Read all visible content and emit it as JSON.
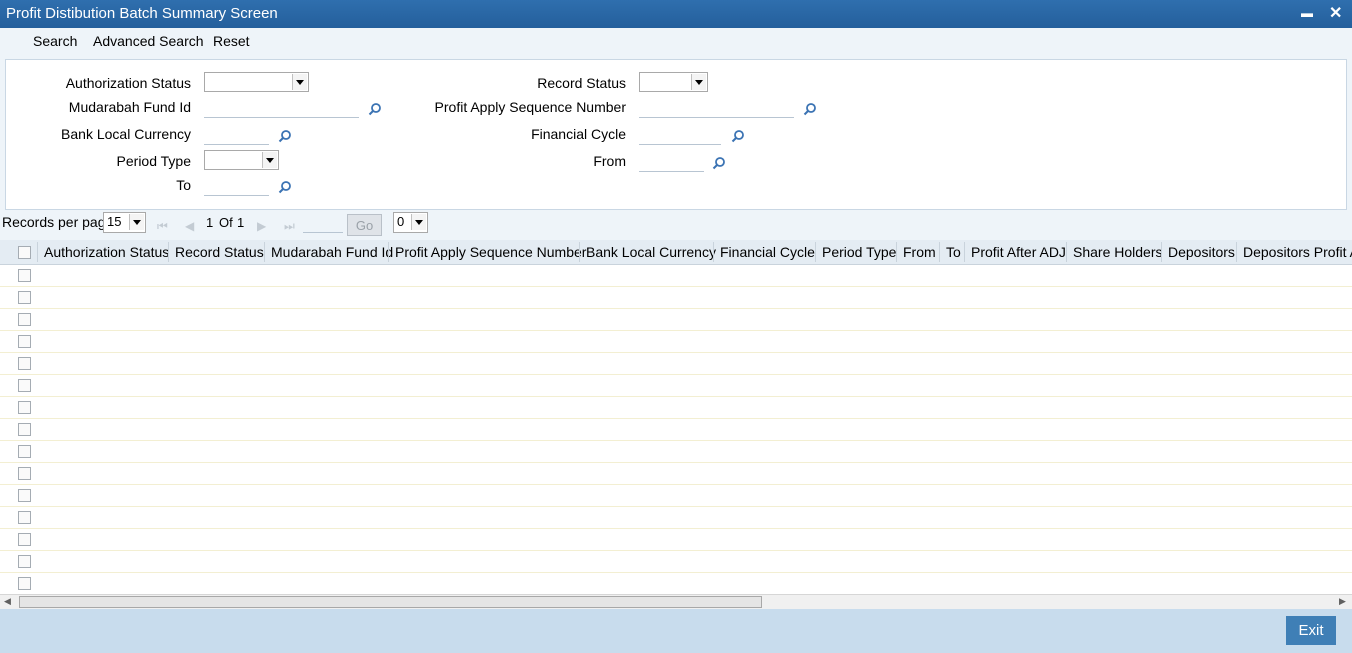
{
  "window": {
    "title": "Profit Distibution Batch Summary Screen",
    "minimize": "▬",
    "close": "✕"
  },
  "menu": {
    "search": "Search",
    "advanced_search": "Advanced Search",
    "reset": "Reset"
  },
  "form": {
    "authorization_status": "Authorization Status",
    "record_status": "Record Status",
    "mudarabah_fund_id": "Mudarabah Fund Id",
    "profit_apply_sequence_number": "Profit Apply Sequence Number",
    "bank_local_currency": "Bank Local Currency",
    "financial_cycle": "Financial Cycle",
    "period_type": "Period Type",
    "from": "From",
    "to": "To"
  },
  "pager": {
    "records_per_page_label": "Records per page",
    "records_per_page": "15",
    "page_current": "1",
    "page_of": "Of",
    "page_total": "1",
    "go": "Go",
    "secondary_select": "0"
  },
  "grid": {
    "columns": [
      "Authorization Status",
      "Record Status",
      "Mudarabah Fund Id",
      "Profit Apply Sequence Number",
      "Bank Local Currency",
      "Financial Cycle",
      "Period Type",
      "From",
      "To",
      "Profit After ADJ",
      "Share Holders",
      "Depositors",
      "Depositors Profit A"
    ],
    "row_count": 15
  },
  "footer": {
    "exit": "Exit"
  },
  "colors": {
    "titlebar": "#2a67a6",
    "footer": "#c8dced",
    "exit_button": "#3f7fb6",
    "lens_icon": "#3b73b3"
  }
}
